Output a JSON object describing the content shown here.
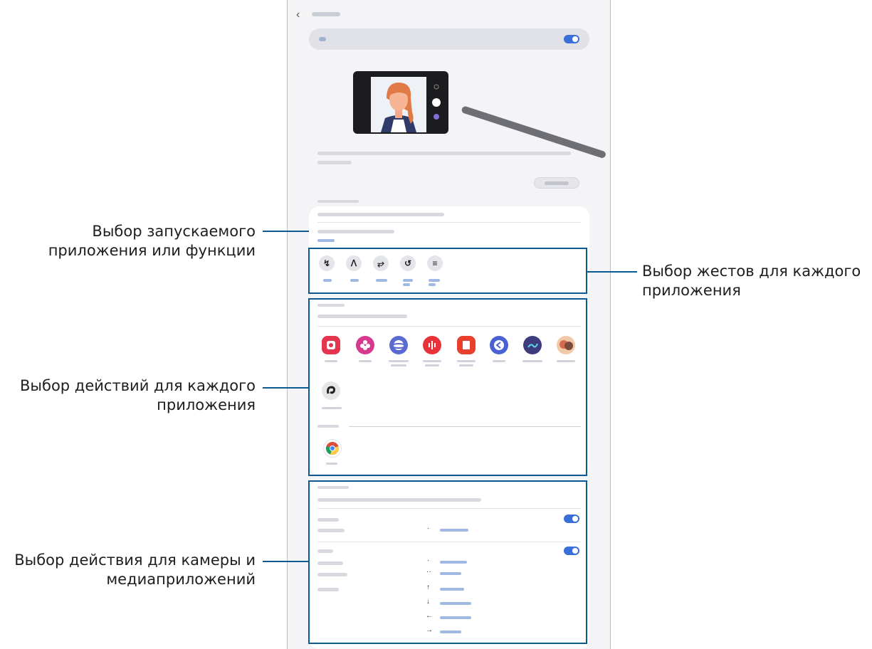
{
  "callouts": {
    "launch_app": {
      "line1": "Выбор запускаемого",
      "line2": "приложения или функции"
    },
    "gestures": {
      "line1": "Выбор жестов для каждого",
      "line2": "приложения"
    },
    "app_actions": {
      "line1": "Выбор действий для каждого",
      "line2": "приложения"
    },
    "camera_media": {
      "line1": "Выбор действия для камеры и",
      "line2": "медиаприложений"
    }
  },
  "screen": {
    "back_glyph": "‹",
    "gesture_glyphs": [
      "↯",
      "ᐱ",
      "⥂",
      "↺",
      "≡"
    ],
    "action_arrows": [
      "·",
      "··",
      "↑",
      "↓",
      "←",
      "→"
    ],
    "single_dot": "·"
  },
  "colors": {
    "accent": "#0a5a8f",
    "toggle_on": "#3b6fd8"
  },
  "icons": {
    "apps_row1": [
      "camera-app-icon",
      "bixby-vision-icon",
      "samsung-internet-icon",
      "voice-recorder-icon",
      "samsung-notes-icon",
      "smart-select-icon",
      "penup-icon",
      "ar-emoji-icon"
    ],
    "apps_row2": [
      "clip-studio-icon"
    ],
    "apps_row3": [
      "chrome-icon"
    ]
  }
}
